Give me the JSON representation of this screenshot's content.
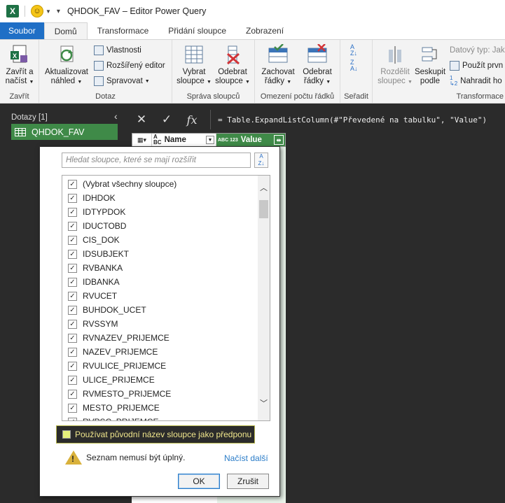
{
  "window": {
    "title": "QHDOK_FAV – Editor Power Query",
    "app_icon_letter": "X"
  },
  "tabs": [
    "Soubor",
    "Domů",
    "Transformace",
    "Přidání sloupce",
    "Zobrazení"
  ],
  "ribbon": {
    "close_group": {
      "label": "Zavřít",
      "btn_line1": "Zavřít a",
      "btn_line2": "načíst"
    },
    "query_group": {
      "label": "Dotaz",
      "refresh_line1": "Aktualizovat",
      "refresh_line2": "náhled",
      "properties": "Vlastnosti",
      "advanced_editor": "Rozšířený editor",
      "manage": "Spravovat"
    },
    "manage_cols_group": {
      "label": "Správa sloupců",
      "choose_line1": "Vybrat",
      "choose_line2": "sloupce",
      "remove_line1": "Odebrat",
      "remove_line2": "sloupce"
    },
    "reduce_rows_group": {
      "label": "Omezení počtu řádků",
      "keep_line1": "Zachovat",
      "keep_line2": "řádky",
      "remove_line1": "Odebrat",
      "remove_line2": "řádky"
    },
    "sort_group": {
      "label": "Seřadit"
    },
    "transform_group": {
      "label": "Transformace",
      "split_line1": "Rozdělit",
      "split_line2": "sloupec",
      "group_line1": "Seskupit",
      "group_line2": "podle",
      "datatype": "Datový typ: Jaké",
      "first_row": "Použít prvn",
      "replace": "Nahradit ho"
    }
  },
  "queries_pane": {
    "title": "Dotazy [1]",
    "items": [
      "QHDOK_FAV"
    ]
  },
  "formula_bar": {
    "cancel": "✕",
    "commit": "✓",
    "fx": "fx",
    "formula": "= Table.ExpandListColumn(#\"Převedené na tabulku\", \"Value\")"
  },
  "grid": {
    "columns": [
      {
        "type_icon": "ABC",
        "name": "Name"
      },
      {
        "type_icon": "ABC 123",
        "name": "Value"
      }
    ]
  },
  "expand_popup": {
    "search_placeholder": "Hledat sloupce, které se mají rozšířit",
    "sort_icon": "A↓Z",
    "columns": [
      {
        "label": "(Vybrat všechny sloupce)",
        "checked": true
      },
      {
        "label": "IDHDOK",
        "checked": true
      },
      {
        "label": "IDTYPDOK",
        "checked": true
      },
      {
        "label": "IDUCTOBD",
        "checked": true
      },
      {
        "label": "CIS_DOK",
        "checked": true
      },
      {
        "label": "IDSUBJEKT",
        "checked": true
      },
      {
        "label": "RVBANKA",
        "checked": true
      },
      {
        "label": "IDBANKA",
        "checked": true
      },
      {
        "label": "RVUCET",
        "checked": true
      },
      {
        "label": "BUHDOK_UCET",
        "checked": true
      },
      {
        "label": "RVSSYM",
        "checked": true
      },
      {
        "label": "RVNAZEV_PRIJEMCE",
        "checked": true
      },
      {
        "label": "NAZEV_PRIJEMCE",
        "checked": true
      },
      {
        "label": "RVULICE_PRIJEMCE",
        "checked": true
      },
      {
        "label": "ULICE_PRIJEMCE",
        "checked": true
      },
      {
        "label": "RVMESTO_PRIJEMCE",
        "checked": true
      },
      {
        "label": "MESTO_PRIJEMCE",
        "checked": true
      },
      {
        "label": "RVPSC_PRIJEMCE",
        "checked": true
      }
    ],
    "prefix_option": "Používat původní název sloupce jako předponu",
    "warning": "Seznam nemusí být úplný.",
    "load_more": "Načíst další",
    "ok": "OK",
    "cancel": "Zrušit"
  }
}
